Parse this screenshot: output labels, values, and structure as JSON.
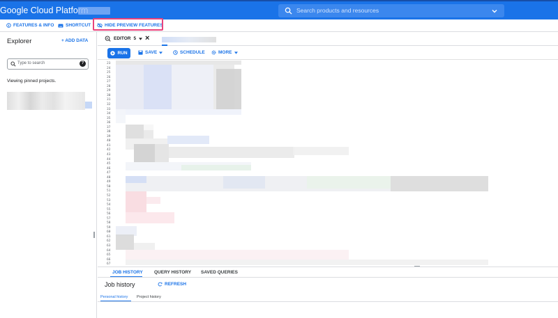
{
  "topbar": {
    "brand": "Google Cloud Platform",
    "search_placeholder": "Search products and resources"
  },
  "subbar": {
    "features_info": "FEATURES & INFO",
    "shortcut": "SHORTCUT",
    "hide_preview": "HIDE PREVIEW FEATURES"
  },
  "explorer": {
    "title": "Explorer",
    "add_data": "+ ADD DATA",
    "search_placeholder": "Type to search",
    "help": "?",
    "pinned_text": "Viewing pinned projects."
  },
  "editor": {
    "tab_label": "EDITOR",
    "tab_number": "5",
    "close_glyph": "×",
    "actions": {
      "run": "RUN",
      "save": "SAVE",
      "schedule": "SCHEDULE",
      "more": "MORE"
    },
    "line_numbers": [
      "23",
      "24",
      "25",
      "26",
      "27",
      "28",
      "29",
      "30",
      "31",
      "32",
      "33",
      "34",
      "35",
      "36",
      "37",
      "38",
      "39",
      "40",
      "41",
      "42",
      "43",
      "44",
      "45",
      "46",
      "47",
      "48",
      "49",
      "50",
      "51",
      "52",
      "53",
      "54",
      "55",
      "56",
      "57",
      "58",
      "59",
      "60",
      "61",
      "62",
      "63",
      "64",
      "65",
      "66",
      "67"
    ]
  },
  "bottom": {
    "tabs": [
      "JOB HISTORY",
      "QUERY HISTORY",
      "SAVED QUERIES"
    ],
    "title": "Job history",
    "refresh": "REFRESH",
    "subtabs": [
      "Personal history",
      "Project history"
    ]
  },
  "colors": {
    "brand_blue": "#1a73e8",
    "highlight_pink": "#e8437c"
  }
}
